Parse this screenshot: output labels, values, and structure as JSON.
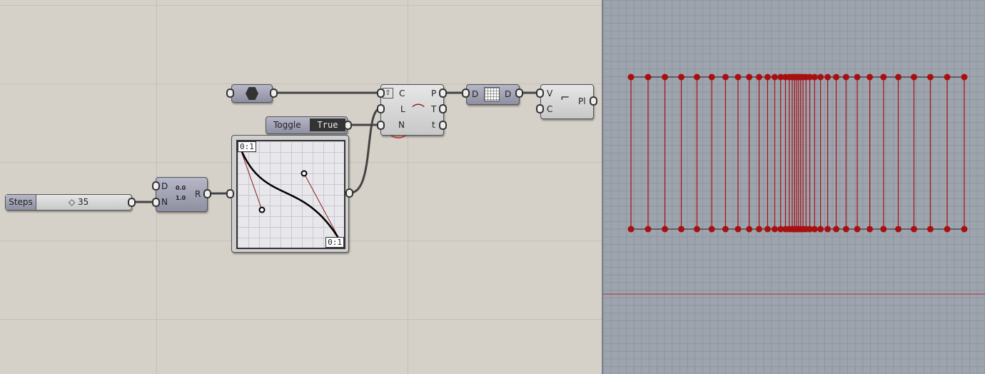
{
  "slider": {
    "label": "Steps",
    "value": "35"
  },
  "range": {
    "inputs": [
      "D",
      "N"
    ],
    "output": "R",
    "icon_top": "0.0",
    "icon_bottom": "1.0"
  },
  "graph": {
    "label_top": "0:1",
    "label_bottom": "0:1"
  },
  "toggle": {
    "label": "Toggle",
    "value": "True"
  },
  "divide": {
    "inputs": [
      "C",
      "L",
      "N"
    ],
    "outputs": [
      "P",
      "T",
      "t"
    ]
  },
  "flip": {
    "input": "D",
    "output": "D"
  },
  "polyline": {
    "inputs": [
      "V",
      "C"
    ],
    "output": "Pl"
  },
  "colors": {
    "points": "#a81010",
    "highlight": "#e05050"
  }
}
